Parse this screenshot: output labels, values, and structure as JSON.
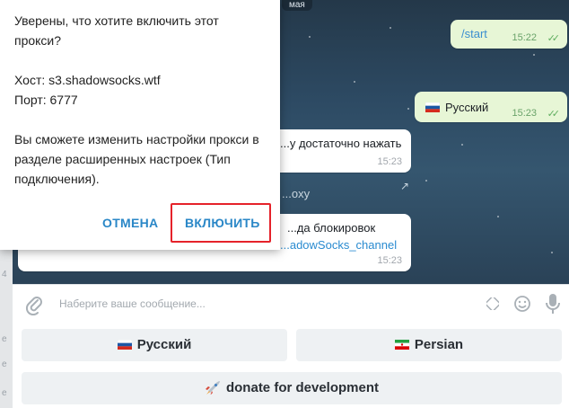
{
  "dialog": {
    "question": "Уверены, что хотите включить этот прокси?",
    "host": "Хост: s3.shadowsocks.wtf",
    "port": "Порт: 6777",
    "note": "Вы сможете изменить настройки прокси в разделе расширенных настроек (Тип подключения).",
    "cancel": "ОТМЕНА",
    "enable": "ВКЛЮЧИТЬ"
  },
  "chat": {
    "date_chip": "мая",
    "messages": [
      {
        "text": "/start",
        "time": "15:22",
        "dir": "out"
      },
      {
        "text": "Русский",
        "time": "15:23",
        "dir": "out"
      },
      {
        "text": "...у достаточно нажать",
        "time": "15:23",
        "dir": "in"
      },
      {
        "text": "...oxy",
        "dir": "in"
      },
      {
        "text": "...да блокировок",
        "link": "...adowSocks_channel",
        "time": "15:23",
        "dir": "in"
      }
    ]
  },
  "composer": {
    "placeholder": "Наберите ваше сообщение..."
  },
  "keyboard": {
    "buttons": [
      {
        "label": "Русский"
      },
      {
        "label": "Persian"
      },
      {
        "label": "donate for development"
      }
    ]
  },
  "left_strip": [
    "4",
    "e",
    "e",
    "e"
  ],
  "colors": {
    "accent": "#2a87c7",
    "highlight": "#e5222a",
    "out_bubble": "#e7f6d6"
  }
}
